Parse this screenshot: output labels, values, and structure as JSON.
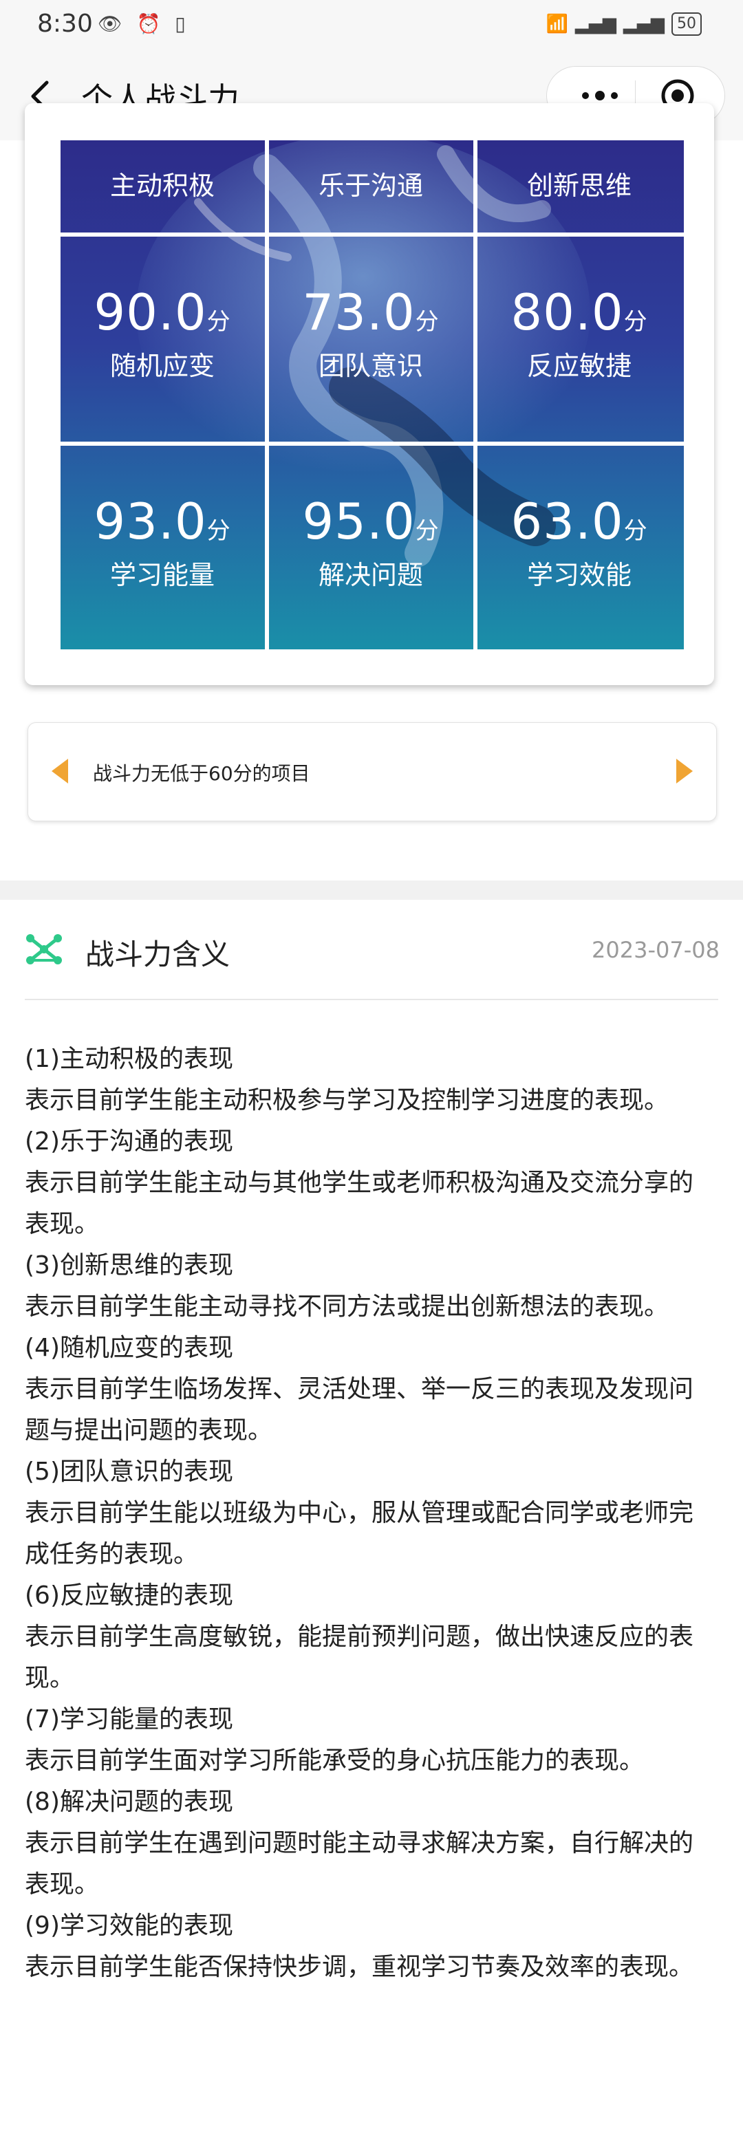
{
  "status_bar": {
    "time": "8:30",
    "battery": "50"
  },
  "nav": {
    "title": "个人战斗力"
  },
  "grid": {
    "cells": [
      {
        "label": "主动积极"
      },
      {
        "label": "乐于沟通"
      },
      {
        "label": "创新思维"
      },
      {
        "score": "90.0",
        "unit": "分",
        "label": "随机应变"
      },
      {
        "score": "73.0",
        "unit": "分",
        "label": "团队意识"
      },
      {
        "score": "80.0",
        "unit": "分",
        "label": "反应敏捷"
      },
      {
        "score": "93.0",
        "unit": "分",
        "label": "学习能量"
      },
      {
        "score": "95.0",
        "unit": "分",
        "label": "解决问题"
      },
      {
        "score": "63.0",
        "unit": "分",
        "label": "学习效能"
      }
    ]
  },
  "filter": {
    "text": "战斗力无低于60分的项目"
  },
  "meaning": {
    "title": "战斗力含义",
    "date": "2023-07-08",
    "items": [
      {
        "title": "(1)主动积极的表现",
        "desc": "表示目前学生能主动积极参与学习及控制学习进度的表现。"
      },
      {
        "title": "(2)乐于沟通的表现",
        "desc": "表示目前学生能主动与其他学生或老师积极沟通及交流分享的表现。"
      },
      {
        "title": "(3)创新思维的表现",
        "desc": "表示目前学生能主动寻找不同方法或提出创新想法的表现。"
      },
      {
        "title": "(4)随机应变的表现",
        "desc": "表示目前学生临场发挥、灵活处理、举一反三的表现及发现问题与提出问题的表现。"
      },
      {
        "title": "(5)团队意识的表现",
        "desc": "表示目前学生能以班级为中心，服从管理或配合同学或老师完成任务的表现。"
      },
      {
        "title": "(6)反应敏捷的表现",
        "desc": "表示目前学生高度敏锐，能提前预判问题，做出快速反应的表现。"
      },
      {
        "title": "(7)学习能量的表现",
        "desc": "表示目前学生面对学习所能承受的身心抗压能力的表现。"
      },
      {
        "title": "(8)解决问题的表现",
        "desc": "表示目前学生在遇到问题时能主动寻求解决方案，自行解决的表现。"
      },
      {
        "title": "(9)学习效能的表现",
        "desc": "表示目前学生能否保持快步调，重视学习节奏及效率的表现。"
      }
    ]
  },
  "colors": {
    "accent_arrow": "#f0a433",
    "grid_top": "#2d2c8a",
    "grid_bottom": "#1a8fa8",
    "icon_green": "#2ec98a"
  }
}
